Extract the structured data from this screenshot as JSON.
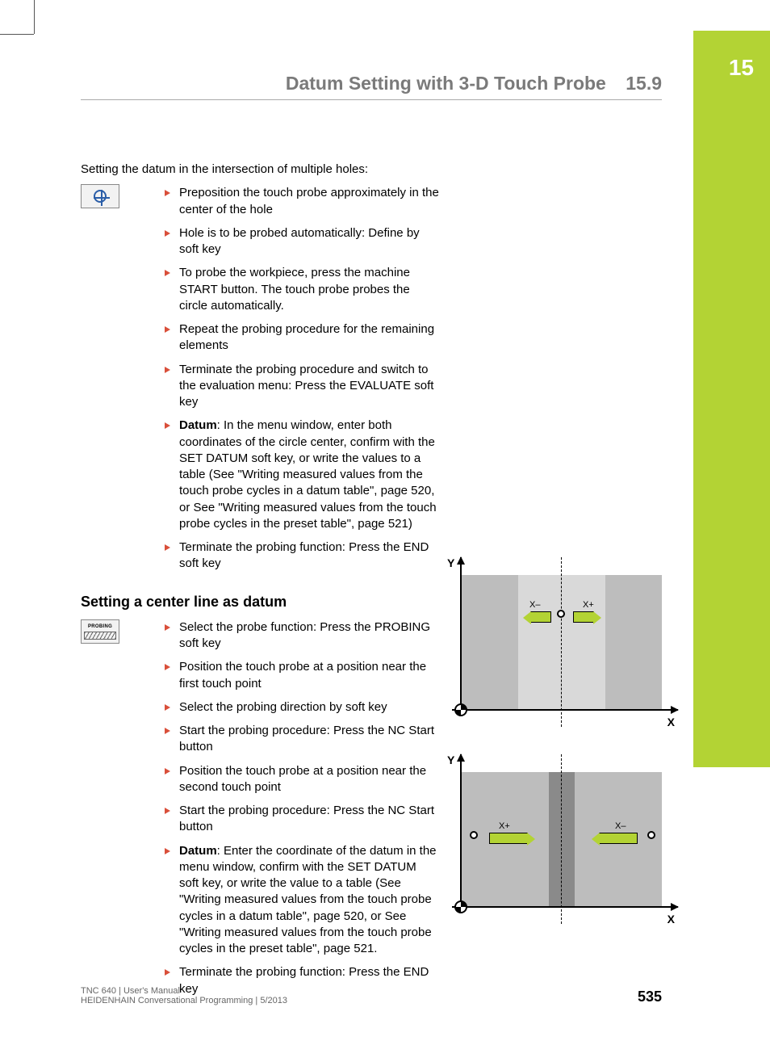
{
  "chapter_tab": "15",
  "header": {
    "title": "Datum Setting with 3-D Touch Probe",
    "section": "15.9"
  },
  "section1": {
    "intro": "Setting the datum in the intersection of multiple holes:",
    "steps": [
      "Preposition the touch probe approximately in the center of the hole",
      "Hole is to be probed automatically: Define by soft key",
      "To probe the workpiece, press the machine START button. The touch probe probes the circle automatically.",
      "Repeat the probing procedure for the remaining elements",
      "Terminate the probing procedure and switch to the evaluation menu: Press the EVALUATE soft key",
      {
        "bold": "Datum",
        "rest": ": In the menu window, enter both coordinates of the circle center, confirm with the SET DATUM soft key, or write the values to a table (See \"Writing measured values from the touch probe cycles in a datum table\", page 520, or See \"Writing measured values from the touch probe cycles in the preset table\", page 521)"
      },
      "Terminate the probing function: Press the END soft key"
    ]
  },
  "section2": {
    "heading": "Setting a center line as datum",
    "icon_label": "PROBING",
    "steps": [
      "Select the probe function: Press the PROBING soft key",
      "Position the touch probe at a position near the first touch point",
      "Select the probing direction by soft key",
      "Start the probing procedure: Press the NC Start button",
      "Position the touch probe at a position near the second touch point",
      "Start the probing procedure: Press the NC Start button",
      {
        "bold": "Datum",
        "rest": ": Enter the coordinate of the datum in the menu window, confirm with the SET DATUM soft key, or write the value to a table (See \"Writing measured values from the touch probe cycles in a datum table\", page 520, or See \"Writing measured values from the touch probe cycles in the preset table\", page 521."
      },
      "Terminate the probing function: Press the END key"
    ]
  },
  "diagram": {
    "d1": {
      "y": "Y",
      "x": "X",
      "xminus": "X–",
      "xplus": "X+"
    },
    "d2": {
      "y": "Y",
      "x": "X",
      "xplus": "X+",
      "xminus": "X–"
    }
  },
  "footer": {
    "line1": "TNC 640 | User's Manual",
    "line2": "HEIDENHAIN Conversational Programming | 5/2013",
    "page": "535"
  }
}
